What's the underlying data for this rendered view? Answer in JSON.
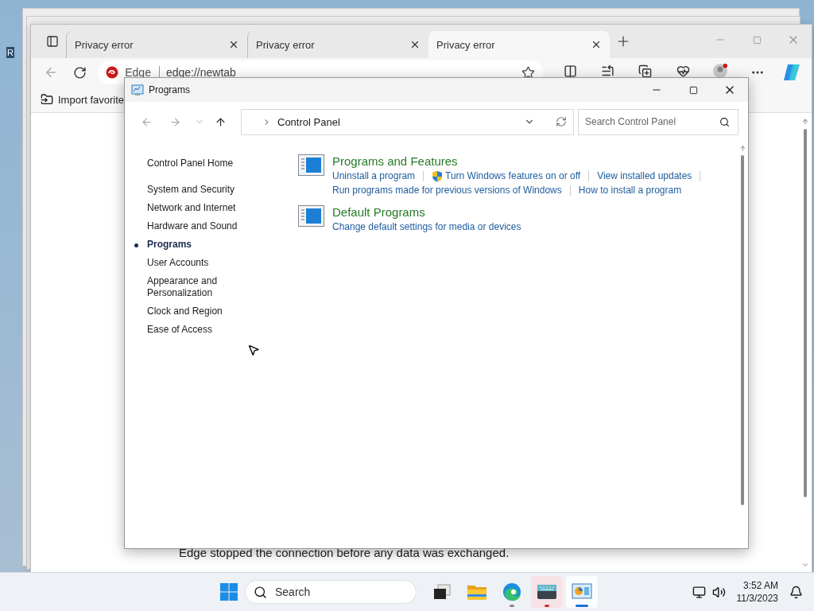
{
  "desktop": {
    "icon_label": "R"
  },
  "browser": {
    "tabs": [
      {
        "title": "Privacy error",
        "selected": false
      },
      {
        "title": "Privacy error",
        "selected": false
      },
      {
        "title": "Privacy error",
        "selected": true
      }
    ],
    "address": {
      "site": "Edge",
      "url": "edge://newtab"
    },
    "favorites": [
      {
        "label": "Import favorite"
      }
    ],
    "message": "Edge stopped the connection before any data was exchanged."
  },
  "control_panel": {
    "title": "Programs",
    "breadcrumb": "Control Panel",
    "search": {
      "placeholder": "Search Control Panel"
    },
    "home": "Control Panel Home",
    "categories": [
      {
        "label": "System and Security",
        "selected": false
      },
      {
        "label": "Network and Internet",
        "selected": false
      },
      {
        "label": "Hardware and Sound",
        "selected": false
      },
      {
        "label": "Programs",
        "selected": true
      },
      {
        "label": "User Accounts",
        "selected": false
      },
      {
        "label": "Appearance and Personalization",
        "selected": false
      },
      {
        "label": "Clock and Region",
        "selected": false
      },
      {
        "label": "Ease of Access",
        "selected": false
      }
    ],
    "sections": [
      {
        "title": "Programs and Features",
        "lines": [
          [
            {
              "label": "Uninstall a program",
              "shield": false
            },
            {
              "label": "Turn Windows features on or off",
              "shield": true
            },
            {
              "label": "View installed updates",
              "shield": false
            }
          ],
          [
            {
              "label": "Run programs made for previous versions of Windows",
              "shield": false
            },
            {
              "label": "How to install a program",
              "shield": false
            }
          ]
        ]
      },
      {
        "title": "Default Programs",
        "lines": [
          [
            {
              "label": "Change default settings for media or devices",
              "shield": false
            }
          ]
        ]
      }
    ]
  },
  "taskbar": {
    "search": {
      "placeholder": "Search"
    },
    "apps": [
      {
        "kind": "taskview",
        "running": false,
        "attention": false,
        "selected": false
      },
      {
        "kind": "explorer",
        "running": false,
        "attention": false,
        "selected": false
      },
      {
        "kind": "edge",
        "running": true,
        "attention": false,
        "selected": false
      },
      {
        "kind": "terminal",
        "running": true,
        "attention": true,
        "selected": false
      },
      {
        "kind": "controlpanel",
        "running": true,
        "attention": false,
        "selected": true
      }
    ],
    "time": "3:52 AM",
    "date": "11/3/2023"
  }
}
